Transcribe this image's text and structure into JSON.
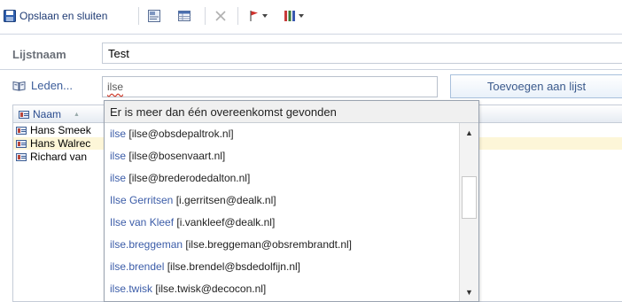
{
  "toolbar": {
    "save_label": "Opslaan en sluiten",
    "icons": [
      "save-icon",
      "address-book-icon",
      "grid-icon",
      "delete-icon",
      "flag-icon",
      "columns-icon"
    ]
  },
  "form": {
    "list_name_label": "Lijstnaam",
    "list_name_value": "Test",
    "members_label": "Leden...",
    "members_input_value": "ilse",
    "add_button_label": "Toevoegen aan lijst"
  },
  "members_list": {
    "column_header": "Naam",
    "sort_indicator": "▲",
    "rows": [
      "Hans Smeek",
      "Hans Walrec",
      "Richard van"
    ]
  },
  "autocomplete": {
    "header": "Er is meer dan één overeenkomst gevonden",
    "items": [
      {
        "name": "ilse",
        "email": "[ilse@obsdepaltrok.nl]"
      },
      {
        "name": "ilse",
        "email": "[ilse@bosenvaart.nl]"
      },
      {
        "name": "ilse",
        "email": "[ilse@brederodedalton.nl]"
      },
      {
        "name": "Ilse Gerritsen",
        "email": "[i.gerritsen@dealk.nl]"
      },
      {
        "name": "Ilse van Kleef",
        "email": "[i.vankleef@dealk.nl]"
      },
      {
        "name": "ilse.breggeman",
        "email": "[ilse.breggeman@obsrembrandt.nl]"
      },
      {
        "name": "ilse.brendel",
        "email": "[ilse.brendel@bsdedolfijn.nl]"
      },
      {
        "name": "ilse.twisk",
        "email": "[ilse.twisk@decocon.nl]"
      }
    ],
    "scroll_up": "▲",
    "scroll_down": "▼"
  },
  "colors": {
    "accent": "#3b5ca8",
    "selected_row": "#fdf6d8",
    "header_bg": "#f0f0f0"
  }
}
